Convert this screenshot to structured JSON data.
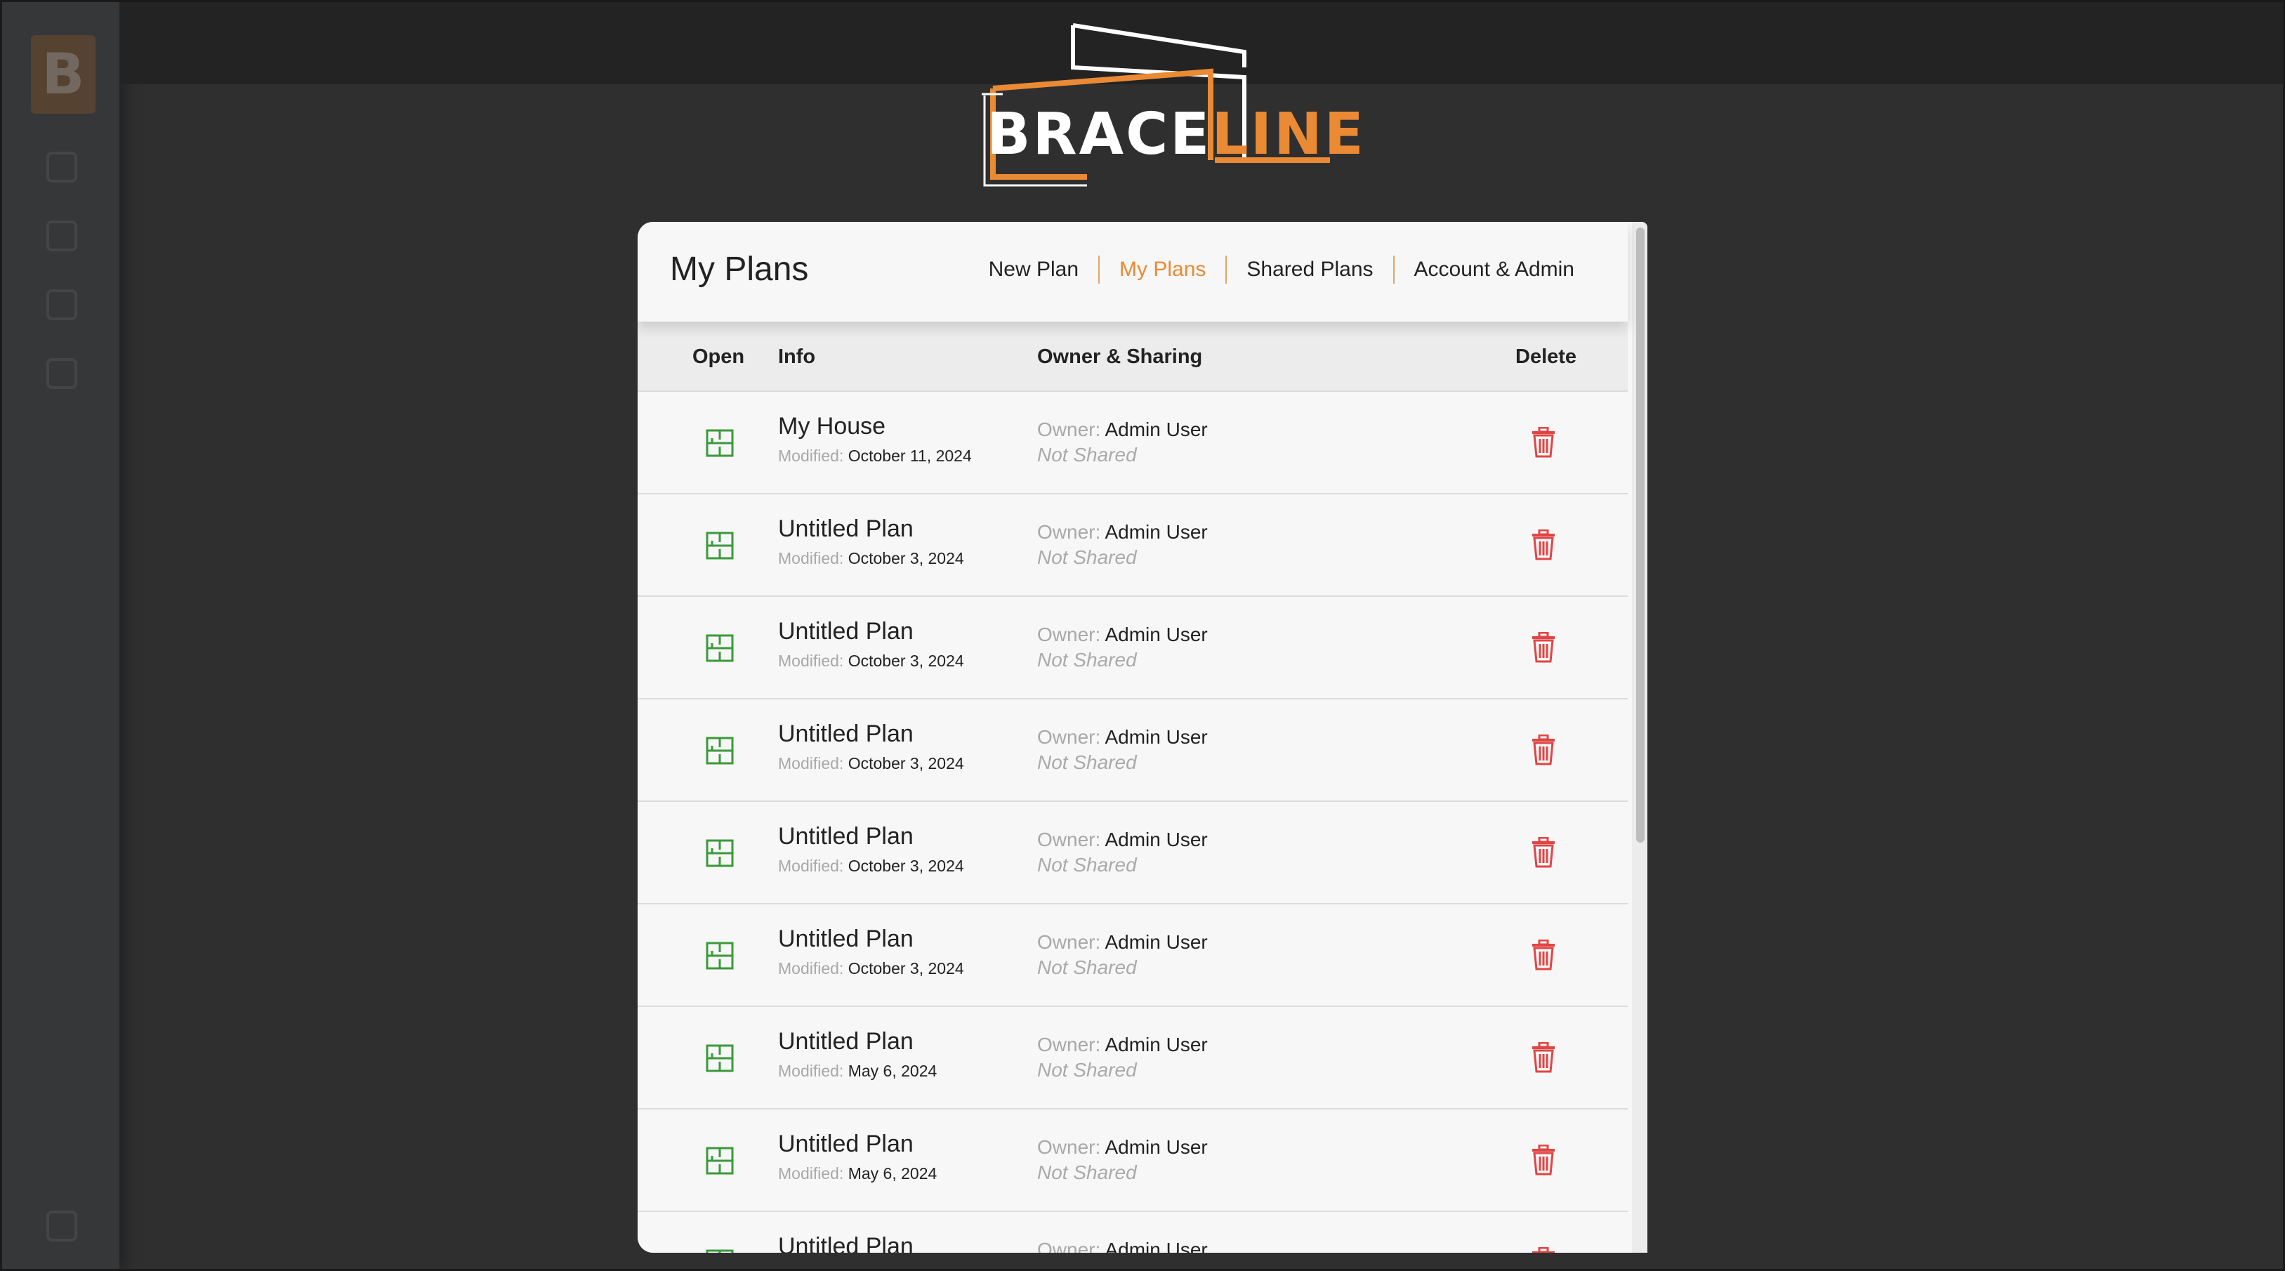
{
  "brand": {
    "part1": "BRACE",
    "part2": "LINE"
  },
  "card": {
    "title": "My Plans"
  },
  "nav": [
    {
      "label": "New Plan",
      "active": false
    },
    {
      "label": "My Plans",
      "active": true
    },
    {
      "label": "Shared Plans",
      "active": false
    },
    {
      "label": "Account & Admin",
      "active": false
    }
  ],
  "table": {
    "headers": {
      "open": "Open",
      "info": "Info",
      "owner": "Owner & Sharing",
      "delete": "Delete"
    },
    "modified_label": "Modified:",
    "owner_label": "Owner:",
    "rows": [
      {
        "name": "My House",
        "modified": "October 11, 2024",
        "owner": "Admin User",
        "sharing": "Not Shared"
      },
      {
        "name": "Untitled Plan",
        "modified": "October 3, 2024",
        "owner": "Admin User",
        "sharing": "Not Shared"
      },
      {
        "name": "Untitled Plan",
        "modified": "October 3, 2024",
        "owner": "Admin User",
        "sharing": "Not Shared"
      },
      {
        "name": "Untitled Plan",
        "modified": "October 3, 2024",
        "owner": "Admin User",
        "sharing": "Not Shared"
      },
      {
        "name": "Untitled Plan",
        "modified": "October 3, 2024",
        "owner": "Admin User",
        "sharing": "Not Shared"
      },
      {
        "name": "Untitled Plan",
        "modified": "October 3, 2024",
        "owner": "Admin User",
        "sharing": "Not Shared"
      },
      {
        "name": "Untitled Plan",
        "modified": "May 6, 2024",
        "owner": "Admin User",
        "sharing": "Not Shared"
      },
      {
        "name": "Untitled Plan",
        "modified": "May 6, 2024",
        "owner": "Admin User",
        "sharing": "Not Shared"
      },
      {
        "name": "Untitled Plan",
        "modified": "",
        "owner": "Admin User",
        "sharing": ""
      }
    ]
  },
  "sidebar": {
    "logo_letter": "B"
  },
  "colors": {
    "accent": "#ea8a35",
    "open_icon": "#3a9a3a",
    "delete_icon": "#e04545",
    "background": "#2f2f2f"
  },
  "icons": {
    "open": "floorplan-icon",
    "delete": "trash-icon"
  }
}
